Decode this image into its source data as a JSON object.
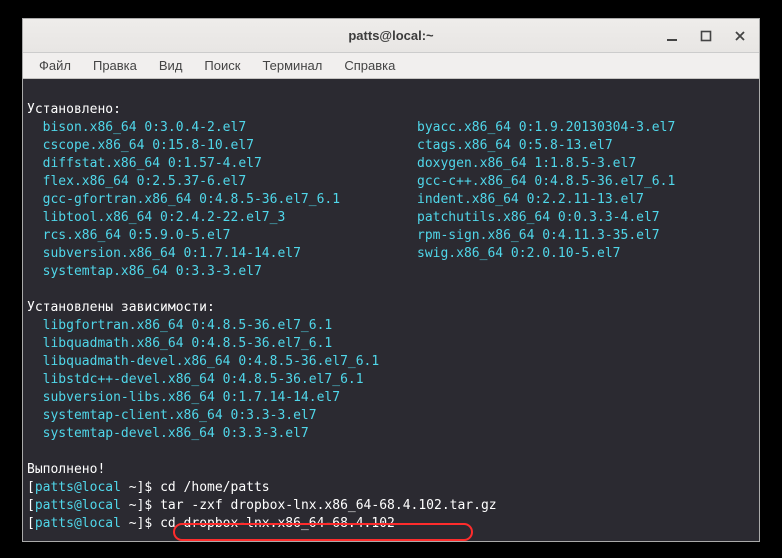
{
  "window": {
    "title": "patts@local:~"
  },
  "menu": {
    "items": [
      {
        "label": "Файл"
      },
      {
        "label": "Правка"
      },
      {
        "label": "Вид"
      },
      {
        "label": "Поиск"
      },
      {
        "label": "Терминал"
      },
      {
        "label": "Справка"
      }
    ]
  },
  "terminal": {
    "section_installed": "Установлено:",
    "installed_packages": {
      "row0_left": "  bison.x86_64 0:3.0.4-2.el7",
      "row0_right": "byacc.x86_64 0:1.9.20130304-3.el7",
      "row1_left": "  cscope.x86_64 0:15.8-10.el7",
      "row1_right": "ctags.x86_64 0:5.8-13.el7",
      "row2_left": "  diffstat.x86_64 0:1.57-4.el7",
      "row2_right": "doxygen.x86_64 1:1.8.5-3.el7",
      "row3_left": "  flex.x86_64 0:2.5.37-6.el7",
      "row3_right": "gcc-c++.x86_64 0:4.8.5-36.el7_6.1",
      "row4_left": "  gcc-gfortran.x86_64 0:4.8.5-36.el7_6.1",
      "row4_right": "indent.x86_64 0:2.2.11-13.el7",
      "row5_left": "  libtool.x86_64 0:2.4.2-22.el7_3",
      "row5_right": "patchutils.x86_64 0:0.3.3-4.el7",
      "row6_left": "  rcs.x86_64 0:5.9.0-5.el7",
      "row6_right": "rpm-sign.x86_64 0:4.11.3-35.el7",
      "row7_left": "  subversion.x86_64 0:1.7.14-14.el7",
      "row7_right": "swig.x86_64 0:2.0.10-5.el7",
      "row8_left": "  systemtap.x86_64 0:3.3-3.el7",
      "row8_right": ""
    },
    "blank1": "",
    "section_deps": "Установлены зависимости:",
    "deps": {
      "d0": "  libgfortran.x86_64 0:4.8.5-36.el7_6.1",
      "d1": "  libquadmath.x86_64 0:4.8.5-36.el7_6.1",
      "d2": "  libquadmath-devel.x86_64 0:4.8.5-36.el7_6.1",
      "d3": "  libstdc++-devel.x86_64 0:4.8.5-36.el7_6.1",
      "d4": "  subversion-libs.x86_64 0:1.7.14-14.el7",
      "d5": "  systemtap-client.x86_64 0:3.3-3.el7",
      "d6": "  systemtap-devel.x86_64 0:3.3-3.el7"
    },
    "blank2": "",
    "done": "Выполнено!",
    "prompts": {
      "p1_bracket_open": "[",
      "p1_user": "patts@local",
      "p1_path": " ~",
      "p1_bracket_close": "]$ ",
      "p1_cmd": "cd /home/patts",
      "p2_cmd": "tar -zxf dropbox-lnx.x86_64-68.4.102.tar.gz",
      "p3_cmd": "cd dropbox-lnx.x86_64-68.4.102"
    }
  }
}
